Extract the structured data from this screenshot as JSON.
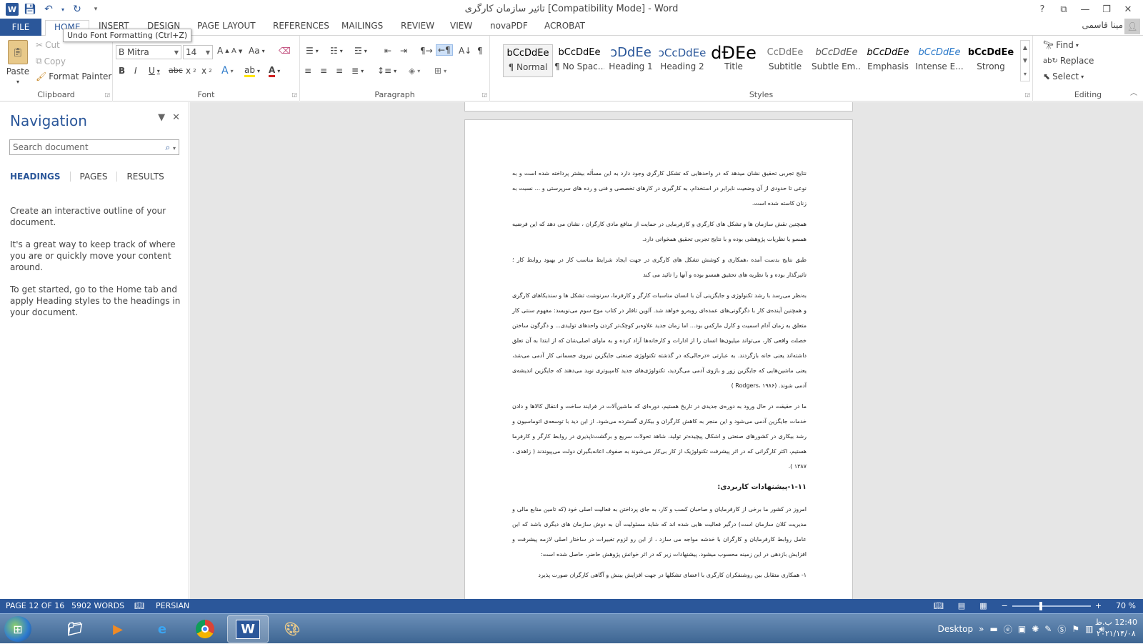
{
  "app": {
    "title": "تاثیر سازمان کارگری [Compatibility Mode] - Word",
    "user": "مینا قاسمی",
    "tooltip": "Undo Font Formatting (Ctrl+Z)",
    "colors": {
      "accent": "#2b579a",
      "status_bar": "#2b579a"
    }
  },
  "window_controls": {
    "help": "?",
    "restore_ribbon": "⧉",
    "minimize": "—",
    "maximize": "❐",
    "close": "✕"
  },
  "tabs": [
    "FILE",
    "HOME",
    "INSERT",
    "DESIGN",
    "PAGE LAYOUT",
    "REFERENCES",
    "MAILINGS",
    "REVIEW",
    "VIEW",
    "novaPDF",
    "ACROBAT"
  ],
  "clipboard": {
    "paste": "Paste",
    "cut": "Cut",
    "copy": "Copy",
    "format_painter": "Format Painter",
    "label": "Clipboard"
  },
  "font": {
    "name": "B Mitra",
    "size": "14",
    "label": "Font"
  },
  "paragraph": {
    "label": "Paragraph"
  },
  "styles": {
    "label": "Styles",
    "items": [
      {
        "preview": "bCcDdEe",
        "name": "¶ Normal"
      },
      {
        "preview": "bCcDdEe",
        "name": "¶ No Spac..."
      },
      {
        "preview": "ↄDdEe",
        "name": "Heading 1"
      },
      {
        "preview": "ↄCcDdEe",
        "name": "Heading 2"
      },
      {
        "preview": "dĐEe",
        "name": "Title"
      },
      {
        "preview": "CcDdEe",
        "name": "Subtitle"
      },
      {
        "preview": "bCcDdEe",
        "name": "Subtle Em..."
      },
      {
        "preview": "bCcDdEe",
        "name": "Emphasis"
      },
      {
        "preview": "bCcDdEe",
        "name": "Intense E..."
      },
      {
        "preview": "bCcDdEe",
        "name": "Strong"
      }
    ]
  },
  "editing": {
    "find": "Find",
    "replace": "Replace",
    "select": "Select",
    "label": "Editing"
  },
  "nav": {
    "title": "Navigation",
    "search_placeholder": "Search document",
    "tabs": [
      "HEADINGS",
      "PAGES",
      "RESULTS"
    ],
    "p1": "Create an interactive outline of your document.",
    "p2": "It's a great way to keep track of where you are or quickly move your content around.",
    "p3": "To get started, go to the Home tab and apply Heading styles to the headings in your document."
  },
  "document": {
    "paragraphs": [
      "نتایج تجربی تحقیق نشان میدهد که در واحدهایی که تشکل کارگری وجود دارد به این مسأله بیشتر پرداخته شده است و به نوعی تا حدودی از آن وضعیت نابرابر در استخدام، به کارگیری در کارهای تخصصی و فنی و رده های سرپرستی و ... نسبت به زنان کاسته شده است.",
      "همچنین نقش سازمان ها و تشکل های کارگری و کارفرمایی در حمایت از منافع مادی کارگران ، نشان می دهد که این فرضیه همسو با نظریات پژوهشی بوده و با نتایج تجربی تحقیق همخوانی دارد.",
      "طبق نتایج بدست آمده ،همکاری و کوشش تشکل های کارگری در جهت ایجاد شرایط مناسب کار در بهبود روابط کار ؛ تاثیرگذار بوده و با نظریه های تحقیق همسو بوده و آنها را تائید می کند",
      "به‌نظر می‌رسد با رشد تکنولوژی و جایگزینی آن با انسان مناسبات کارگر و کارفرما، سرنوشت تشکل ها و سندیکاهای کارگری و همچنین آینده‌ی کار با دگرگونی‌های عمده‌ای روبه‌رو خواهد شد. آلوین تافلر در کتاب موج سوم می‌نویسد: مفهوم سنتی کار متعلق به زمان آدام اسمیت و کارل مارکس بود... اما زمان جدید علاوه‌بر کوچک‌تر کردن واحدهای تولیدی... و دگرگون ساختن خصلت واقعی کار، می‌تواند میلیون‌ها انسان را از ادارات و کارخانه‌ها آزاد کرده و به ماوای اصلی‌شان که از ابتدا به آن تعلق داشته‌اند یعنی خانه بازگردند. به عبارتی «درحالی‌که در گذشته تکنولوژی صنعتی جایگزین نیروی جسمانی کار آدمی می‌شد، یعنی ماشین‌هایی که جایگزین زور و بازوی آدمی می‌گردید، تکنولوژی‌های جدید کامپیوتری نوید می‌دهند که جایگزین اندیشه‌ی آدمی شوند. (Rodgers، ۱۹۸۶ )",
      "ما در حقیقت در حال ورود به دوره‌ی جدیدی در تاریخ هستیم، دوره‌ای که ماشین‌آلات در فرایند ساخت و انتقال کالاها و دادن خدمات جایگزین آدمی می‌شود و این منجر به کاهش کارگران و بیکاری گسترده می‌شود. از این دید با توسعه‌ی اتوماسیون و رشد بیکاری در کشورهای صنعتی و اشکال پیچیده‌تر تولید، شاهد تحولات سریع و برگشت‌ناپذیری در روابط کارگر و کارفرما هستیم، اکثر کارگرانی که در اثر پیشرفت تکنولوژیک از کار بی‌کار می‌شوند به صفوف اعانه‌بگیران دولت می‌پیوندند ( زاهدی ، ۱۳۸۷ )."
    ],
    "heading": "۱-۱۱-پیشنهادات کاربردی:",
    "paragraphs2": [
      "امروز در کشور ما برخی از کارفرمایان و صاحبان کسب و کار، به جای پرداختن به فعالیت اصلی خود (که تامین منابع مالی و مدیریت کلان سازمان است) درگیر فعالیت هایی شده اند که شاید مسئولیت آن به دوش سازمان های دیگری باشد که این عامل روابط کارفرمایان و کارگران با خدشه مواجه می سازد ، از این رو لزوم تغییرات در ساختار اصلی لازمه پیشرفت و افزایش بازدهی در این زمینه محسوب میشود. پیشنهادات زیر که در اثر خوانش پژوهش حاضر، حاصل شده است:",
      "۱- همکاری متقابل بین روشنفکران کارگری با اعضای تشکلها در جهت افزایش بینش و آگاهی کارگران صورت پذیرد"
    ]
  },
  "status": {
    "page": "PAGE 12 OF 16",
    "words": "5902 WORDS",
    "language": "PERSIAN",
    "zoom": "70 %"
  },
  "taskbar": {
    "desktop": "Desktop",
    "time": "12:40 ب.ظ",
    "date": "۲۰۲۱/۱۴/۰۸"
  }
}
